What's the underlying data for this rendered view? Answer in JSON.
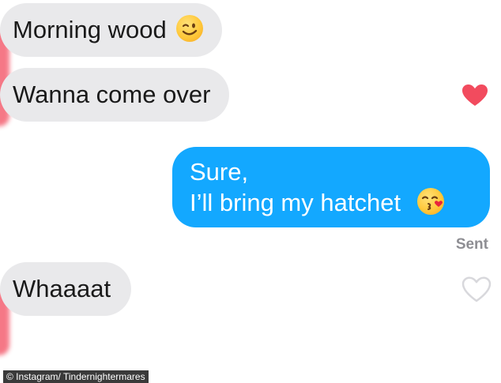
{
  "messages": [
    {
      "text": "Morning wood",
      "emoji": "winking-face-emoji",
      "direction": "received"
    },
    {
      "text": "Wanna come over",
      "direction": "received",
      "liked": true
    },
    {
      "line1": "Sure,",
      "line2": "I’ll bring my hatchet",
      "emoji": "face-blowing-kiss-emoji",
      "direction": "sent",
      "status": "Sent"
    },
    {
      "text": "Whaaaat",
      "direction": "received",
      "liked": false
    }
  ],
  "credit": "© Instagram/ Tindernightermares",
  "colors": {
    "received_bubble": "#e9e9eb",
    "sent_bubble": "#13a8ff",
    "heart_filled": "#f24b5e",
    "heart_outline": "#d8d8dc",
    "status_text": "#8e8e93"
  },
  "icons": {
    "liked": "heart-filled-icon",
    "unliked": "heart-outline-icon"
  }
}
